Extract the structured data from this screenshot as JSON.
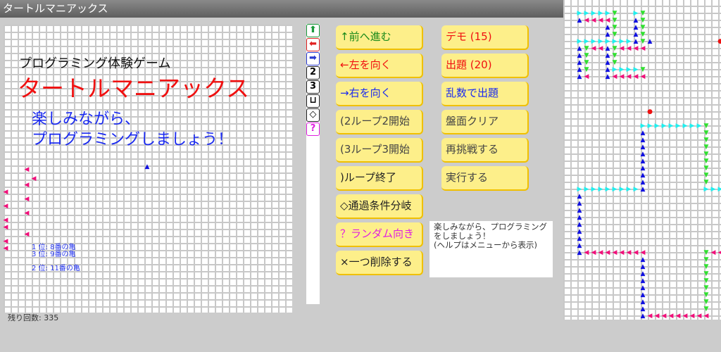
{
  "window": {
    "title": "タートルマニアックス"
  },
  "intro": {
    "subtitle": "プログラミング体験ゲーム",
    "title": "タートルマニアックス",
    "line1": "楽しみながら、",
    "line2": "プログラミングしましょう！"
  },
  "rankings": [
    "1 位: 8番の亀",
    "3 位: 9番の亀",
    "2 位: 11番の亀"
  ],
  "status": {
    "remaining": "残り回数: 335"
  },
  "palette": [
    {
      "icon": "forward-arrow-icon",
      "glyph": "⬆",
      "color": "#1a9a3a"
    },
    {
      "icon": "left-arrow-icon",
      "glyph": "⬅",
      "color": "#e02020"
    },
    {
      "icon": "right-arrow-icon",
      "glyph": "➡",
      "color": "#2a3ad0"
    },
    {
      "icon": "loop2-icon",
      "glyph": "2",
      "color": "#000"
    },
    {
      "icon": "loop3-icon",
      "glyph": "3",
      "color": "#000"
    },
    {
      "icon": "loop-end-icon",
      "glyph": "⊔",
      "color": "#000"
    },
    {
      "icon": "condition-icon",
      "glyph": "◇",
      "color": "#000"
    },
    {
      "icon": "random-icon",
      "glyph": "?",
      "color": "#e020e0"
    }
  ],
  "buttons": {
    "forward": "↑前へ進む",
    "left": "←左を向く",
    "right": "→右を向く",
    "loop2": "(2ループ2開始",
    "loop3": "(3ループ3開始",
    "loop_end": ")ループ終了",
    "condition": "◇通過条件分岐",
    "random": "？ランダム向き",
    "delete": "×一つ削除する",
    "demo": "デモ (15)",
    "quiz": "出題 (20)",
    "random_quiz": "乱数で出題",
    "clear": "盤面クリア",
    "retry": "再挑戦する",
    "run": "実行する"
  },
  "help": {
    "line1": "楽しみながら、プログラミング",
    "line2": "をしましょう！",
    "line3": "(ヘルプはメニューから表示)"
  },
  "colors": {
    "cyan": "#20f0f0",
    "blue": "#1010e0",
    "green": "#30e030",
    "magenta": "#f0107a",
    "red": "#ee1111"
  }
}
